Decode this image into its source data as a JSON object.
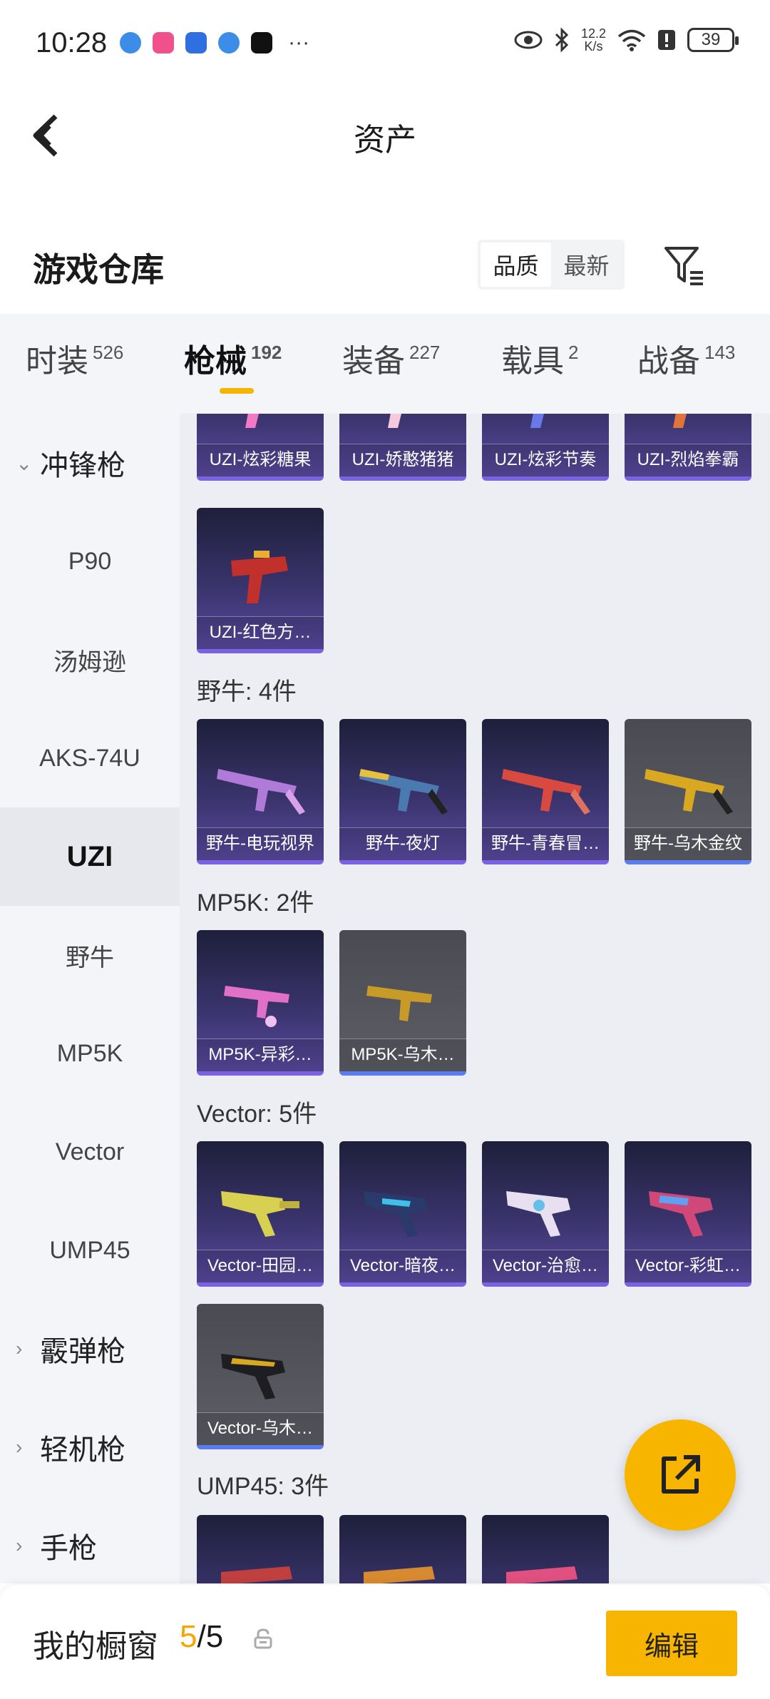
{
  "status_bar": {
    "time": "10:28",
    "more": "···",
    "net_speed_value": "12.2",
    "net_speed_unit": "K/s",
    "battery": "39"
  },
  "header": {
    "title": "资产"
  },
  "warehouse": {
    "title": "游戏仓库",
    "sort_options": [
      "品质",
      "最新"
    ],
    "active_sort": "品质"
  },
  "tabs": [
    {
      "label": "时装",
      "count": "526"
    },
    {
      "label": "枪械",
      "count": "192"
    },
    {
      "label": "装备",
      "count": "227"
    },
    {
      "label": "载具",
      "count": "2"
    },
    {
      "label": "战备",
      "count": "143"
    }
  ],
  "active_tab": "枪械",
  "sidebar": {
    "group_smg": "冲锋枪",
    "items": [
      "P90",
      "汤姆逊",
      "AKS-74U",
      "UZI",
      "野牛",
      "MP5K",
      "Vector",
      "UMP45"
    ],
    "active_item": "UZI",
    "group_shotgun": "霰弹枪",
    "group_lmg": "轻机枪",
    "group_pistol": "手枪"
  },
  "content": {
    "uzi_row1": [
      "UZI-炫彩糖果",
      "UZI-娇憨猪猪",
      "UZI-炫彩节奏",
      "UZI-烈焰拳霸"
    ],
    "uzi_row2": [
      "UZI-红色方…"
    ],
    "bison_label": "野牛: 4件",
    "bison": [
      "野牛-电玩视界",
      "野牛-夜灯",
      "野牛-青春冒…",
      "野牛-乌木金纹"
    ],
    "mp5k_label": "MP5K: 2件",
    "mp5k": [
      "MP5K-异彩…",
      "MP5K-乌木…"
    ],
    "vector_label": "Vector: 5件",
    "vector_row1": [
      "Vector-田园…",
      "Vector-暗夜…",
      "Vector-治愈…",
      "Vector-彩虹…"
    ],
    "vector_row2": [
      "Vector-乌木…"
    ],
    "ump45_label": "UMP45: 3件"
  },
  "bottom": {
    "showcase_label": "我的橱窗",
    "current": "5",
    "total": "/5",
    "edit_label": "编辑"
  },
  "colors": {
    "accent": "#f7b500",
    "card_purple": "#3c3570",
    "card_dark": "#55565e"
  }
}
